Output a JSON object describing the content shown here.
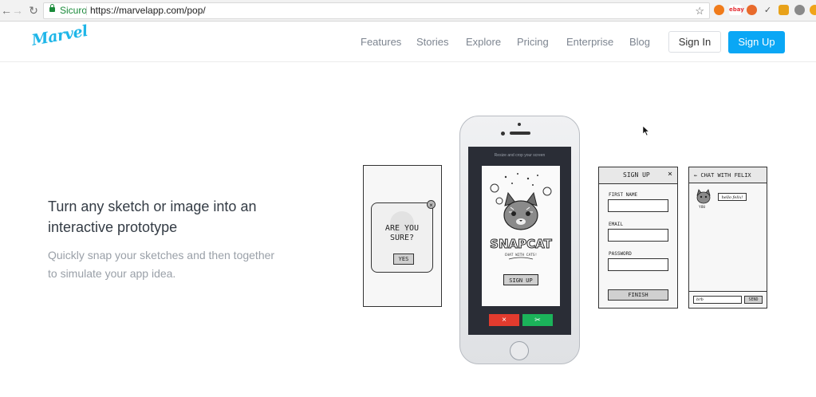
{
  "browser": {
    "secure_label": "Sicuro",
    "url": "https://marvelapp.com/pop/"
  },
  "site": {
    "logo": "Marvel",
    "nav": [
      "Features",
      "Stories",
      "Explore",
      "Pricing",
      "Enterprise",
      "Blog"
    ],
    "sign_in": "Sign In",
    "sign_up": "Sign Up"
  },
  "hero": {
    "title_line1": "Turn any sketch or image into an",
    "title_line2": "interactive prototype",
    "subtitle_line1": "Quickly snap your sketches and then together",
    "subtitle_line2": "to simulate your app idea."
  },
  "sketch_dialog": {
    "line1": "ARE YOU",
    "line2": "SURE?",
    "button": "YES"
  },
  "phone": {
    "header": "Resize and crop your screen",
    "app_name": "SNAPCAT",
    "tagline": "CHAT WITH CATS!",
    "button": "SIGN UP"
  },
  "sketch_signup": {
    "title": "SIGN UP",
    "close": "×",
    "first_name": "FIRST NAME",
    "email": "EMAIL",
    "password": "PASSWORD",
    "finish": "FINISH"
  },
  "sketch_chat": {
    "title": "← CHAT WITH FELIX",
    "bubble": "hello felix!",
    "you": "YOU",
    "input": "brb",
    "send": "SEND"
  },
  "colors": {
    "accent": "#0aa7f5",
    "logo": "#1fb6e8",
    "reject": "#e23b2e",
    "accept": "#1bb35a"
  }
}
